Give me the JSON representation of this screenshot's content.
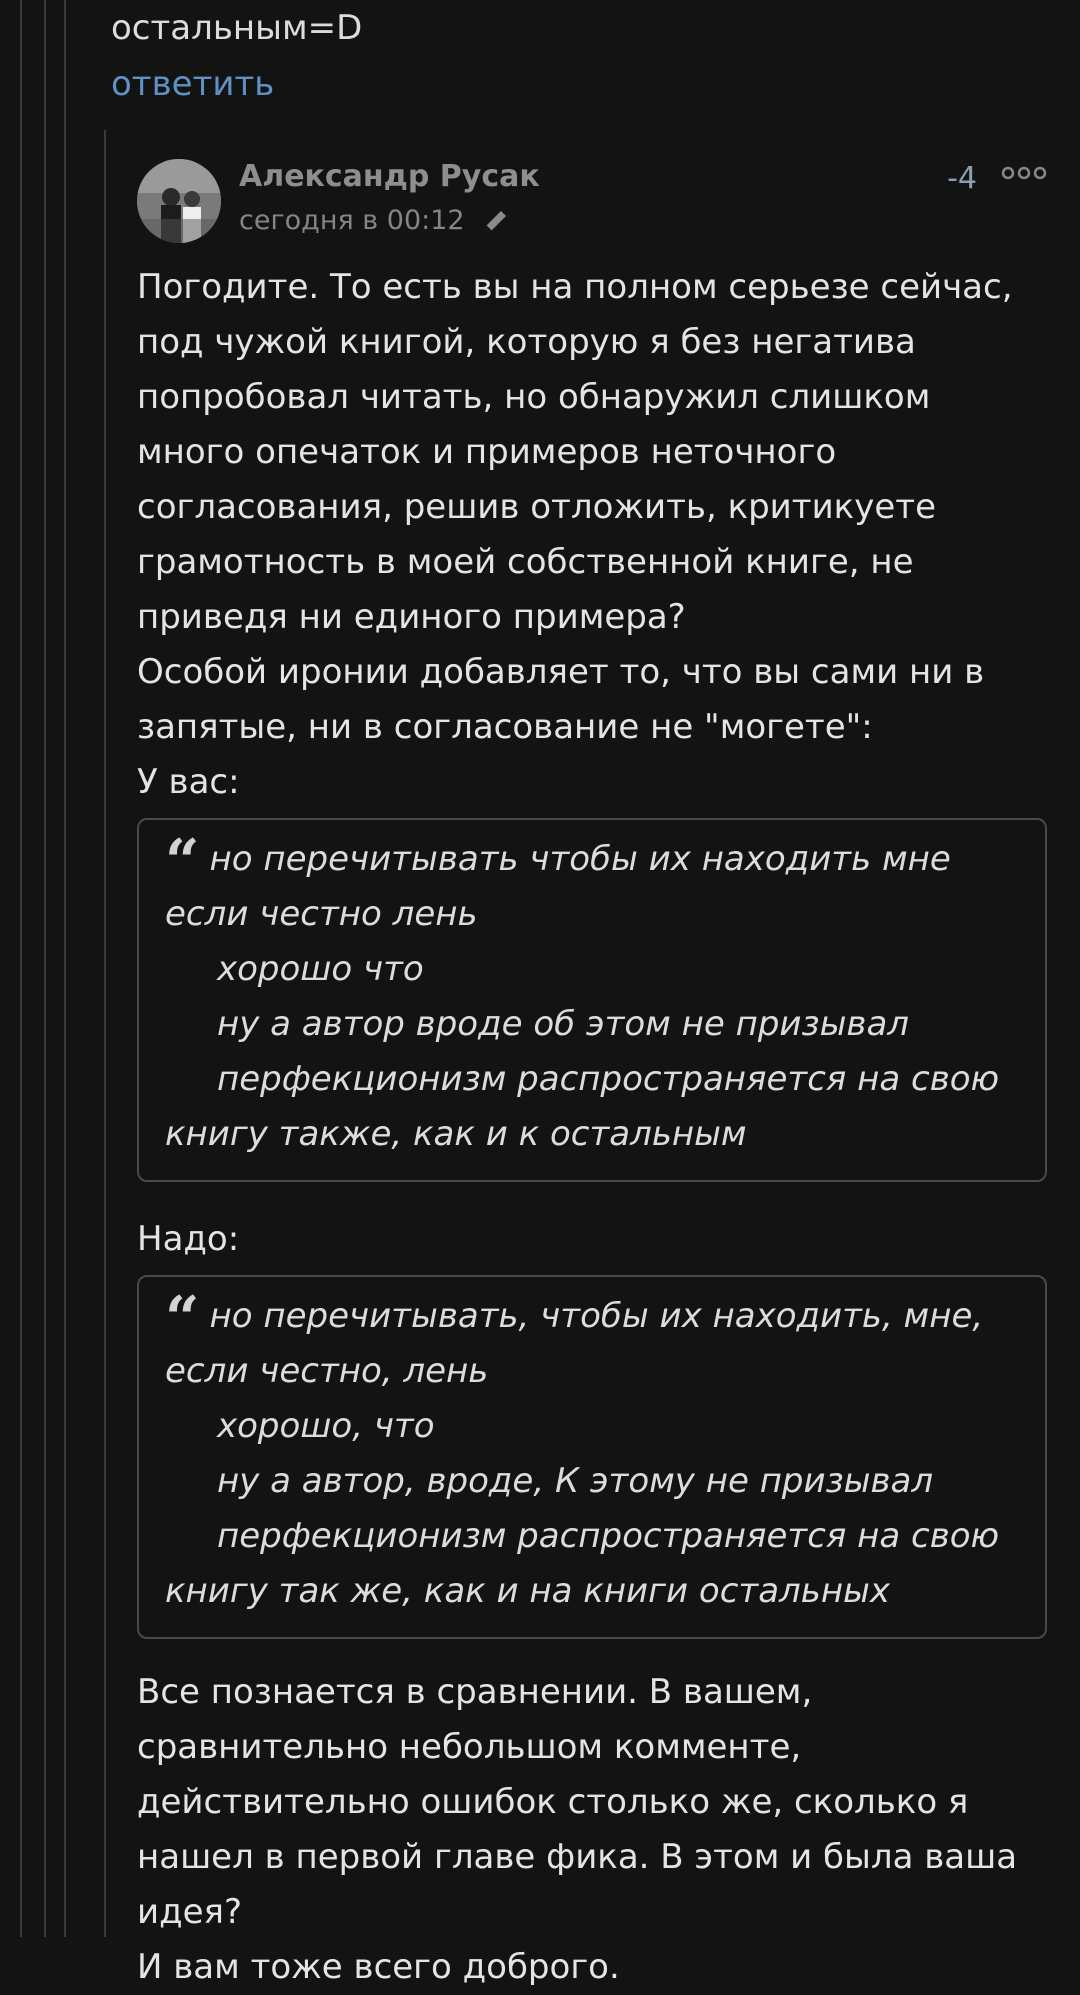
{
  "previous_comment": {
    "tail_text": "остальным=D",
    "reply_label": "ответить"
  },
  "comment": {
    "author": "Александр Русак",
    "timestamp": "сегодня в 00:12",
    "rating": "-4",
    "icons": {
      "avatar": "user-avatar",
      "edit": "pencil-icon",
      "more": "more-dots-icon"
    },
    "paragraph_1": "Погодите. То есть вы на полном серьезе сейчас, под чужой книгой, которую я без негатива попробовал читать, но обнаружил слишком много опечаток и примеров неточного согласования, решив отложить, критикуете грамотность в моей собственной книге, не приведя ни единого примера?",
    "paragraph_2": "Особой иронии добавляет то, что вы сами ни в запятые, ни в согласование не \"могете\":",
    "label_yours": "У вас:",
    "quote_1": {
      "line_1": "но перечитывать чтобы их находить мне если честно лень",
      "line_2": "хорошо что",
      "line_3": "ну а автор вроде об этом не призывал",
      "line_4": "перфекционизм распространяется на свою книгу также, как и к остальным"
    },
    "label_should_be": "Надо:",
    "quote_2": {
      "line_1": "но перечитывать, чтобы их находить, мне, если честно, лень",
      "line_2": "хорошо, что",
      "line_3": "ну а автор, вроде, К этому не призывал",
      "line_4": "перфекционизм распространяется на свою книгу так же, как и на книги остальных"
    },
    "paragraph_3": "Все познается в сравнении. В вашем, сравнительно небольшом комменте, действительно ошибок столько же, сколько я нашел в первой главе фика. В этом и была ваша идея?",
    "paragraph_4": "И вам тоже всего доброго."
  },
  "colors": {
    "background": "#131313",
    "text": "#e4e4e4",
    "link": "#5f92c4",
    "muted": "#858585",
    "rating": "#8a9fb3",
    "quote_border": "#4a4a4a",
    "thread_line": "#3a3a3a"
  }
}
